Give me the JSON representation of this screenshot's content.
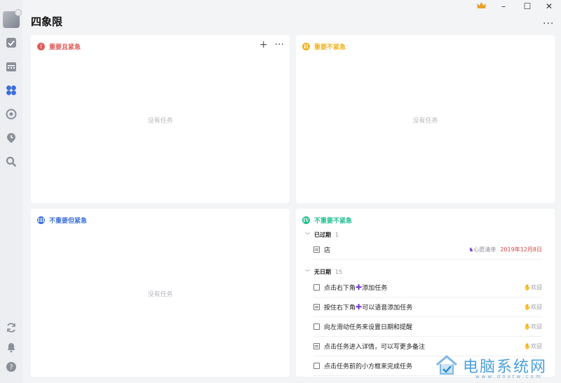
{
  "page_title": "四象限",
  "window": {
    "minimize": "–",
    "maximize": "☐",
    "close": "✕"
  },
  "header_more": "···",
  "quadrants": [
    {
      "badge": "!",
      "title": "重要且紧急",
      "color": "#e05b5b",
      "empty": ""
    },
    {
      "badge": "II",
      "title": "重要不紧急",
      "color": "#f0b323",
      "empty": "没有任务"
    },
    {
      "badge": "III",
      "title": "不重要但紧急",
      "color": "#3b6fd8",
      "empty": "没有任务"
    },
    {
      "badge": "IV",
      "title": "不重要不紧急",
      "color": "#1fbf8f",
      "empty": ""
    }
  ],
  "q1_empty": "没有任务",
  "q1_tools": {
    "add": "+",
    "more": "···"
  },
  "q4": {
    "groups": [
      {
        "name": "已过期",
        "count": "1"
      },
      {
        "name": "无日期",
        "count": "15"
      }
    ],
    "overdue_task": {
      "title": "店",
      "list": "心愿清单",
      "date": "2019年12月8日"
    },
    "tasks": [
      {
        "pre": "点击右下角",
        "plus": "✚",
        "post": "添加任务",
        "tag": "欢迎"
      },
      {
        "pre": "按住右下角",
        "plus": "✚",
        "post": "可以语音添加任务",
        "tag": "欢迎"
      },
      {
        "pre": "向左滑动任务来设置日期和提醒",
        "plus": "",
        "post": "",
        "tag": "欢迎"
      },
      {
        "pre": "点击任务进入详情，可以写更多备注",
        "plus": "",
        "post": "",
        "tag": "欢迎"
      },
      {
        "pre": "点击任务前的小方框来完成任务",
        "plus": "",
        "post": "",
        "tag": ""
      }
    ]
  },
  "watermark": {
    "text": "电脑系统网",
    "url": "www.dnxtw.com"
  }
}
